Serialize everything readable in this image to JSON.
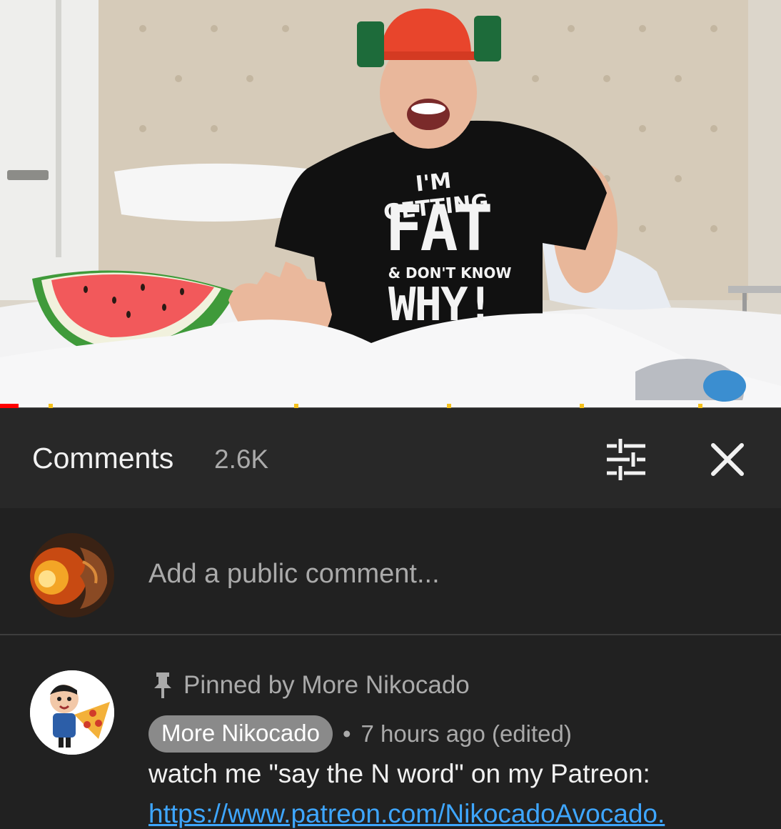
{
  "video": {
    "shirt_lines": [
      "I'M GETTING",
      "FAT",
      "& DON'T KNOW",
      "WHY!"
    ],
    "progress_fraction": 0.024
  },
  "comments": {
    "title": "Comments",
    "count": "2.6K",
    "sort_icon": "sliders-icon",
    "close_icon": "close-icon"
  },
  "add_comment": {
    "placeholder": "Add a public comment..."
  },
  "pinned_comment": {
    "pinned_label": "Pinned by More Nikocado",
    "author": "More Nikocado",
    "separator": "•",
    "time": "7 hours ago (edited)",
    "text": "watch me \"say the N word\" on my Patreon:",
    "link": "https://www.patreon.com/NikocadoAvocado."
  },
  "colors": {
    "background": "#212121",
    "header": "#282828",
    "link": "#3ea6ff",
    "progress_played": "#ff0000",
    "chapter_marker": "#f6c21c"
  }
}
